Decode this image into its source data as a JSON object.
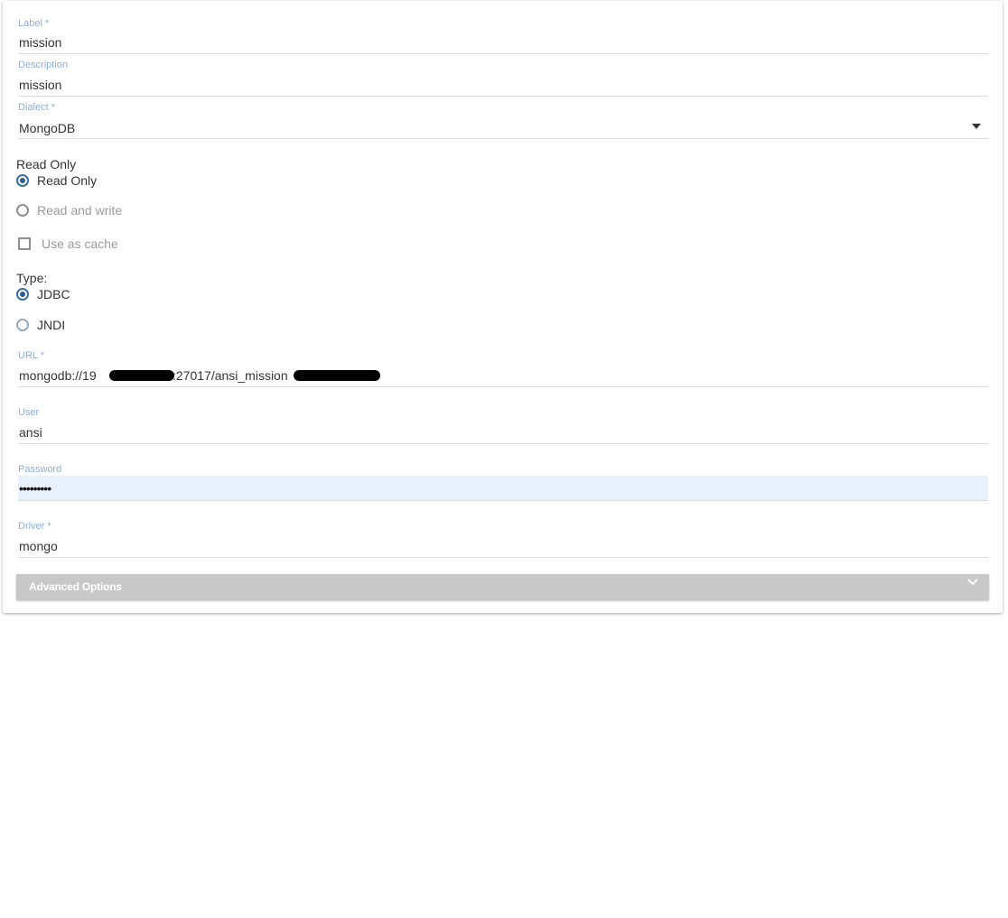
{
  "form": {
    "label": {
      "label": "Label *",
      "value": "mission"
    },
    "description": {
      "label": "Description",
      "value": "mission"
    },
    "dialect": {
      "label": "Dialect *",
      "value": "MongoDB"
    },
    "access": {
      "title": "Read Only",
      "options": [
        "Read Only",
        "Read and write"
      ],
      "selected": "Read Only"
    },
    "cache": {
      "label": "Use as cache",
      "checked": false
    },
    "type": {
      "title": "Type:",
      "options": [
        "JDBC",
        "JNDI"
      ],
      "selected": "JDBC"
    },
    "url": {
      "label": "URL *",
      "part1": "mongodb://19",
      "part2": ":27017/ansi_mission"
    },
    "user": {
      "label": "User",
      "value": "ansi"
    },
    "password": {
      "label": "Password",
      "value": "•••••••••"
    },
    "driver": {
      "label": "Driver *",
      "value": "mongo"
    },
    "advanced": {
      "label": "Advanced Options"
    }
  },
  "colors": {
    "field_label": "#8aaedb",
    "radio_selected": "#2c5c95",
    "password_autofill_bg": "#e8f0fe",
    "advanced_bar": "#c8c8c8"
  },
  "icons": {
    "dialect_dropdown": "caret-down-icon",
    "advanced_toggle": "chevron-down-icon"
  }
}
